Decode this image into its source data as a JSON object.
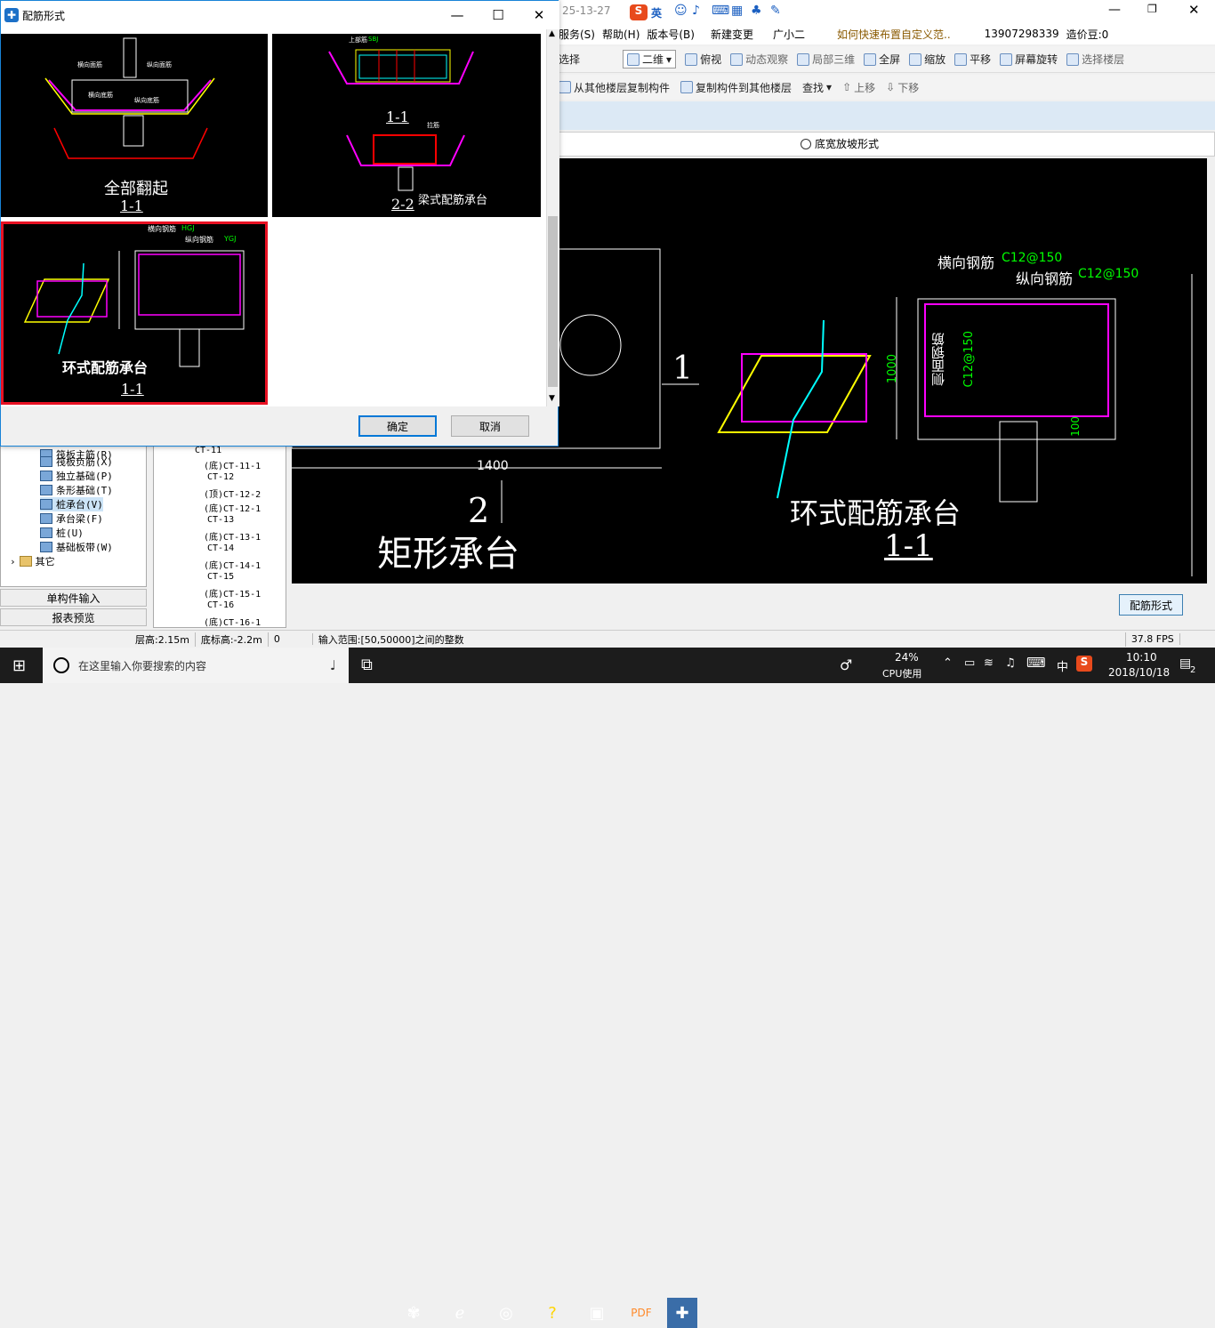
{
  "dialog": {
    "title": "配筋形式",
    "ok_label": "确定",
    "cancel_label": "取消",
    "thumb1_caption": "全部翻起",
    "thumb1_section": "1-1",
    "thumb2_top_label": "1-1",
    "thumb2_bottom_section": "2-2",
    "thumb2_caption": "梁式配筋承台",
    "thumb3_caption": "环式配筋承台",
    "thumb3_section": "1-1",
    "thumb3_label_transverse": "横向钢筋",
    "thumb3_code_transverse": "HGJ",
    "thumb3_label_longitudinal": "纵向钢筋",
    "thumb3_code_longitudinal": "YGJ",
    "thumb1_label_transverse_top": "横向面筋",
    "thumb1_label_longitudinal_top": "纵向面筋",
    "thumb1_label_transverse_bottom": "横向底筋",
    "thumb1_label_longitudinal_bottom": "纵向底筋",
    "thumb2_label_top": "上部筋",
    "thumb2_code_top": "SBJ",
    "thumb2_label_stirrup": "拉筋"
  },
  "app": {
    "menu": [
      "服务(S)",
      "帮助(H)",
      "版本号(B)",
      "新建变更",
      "广小二",
      "如何快速布置自定义范..",
      "13907298339",
      "造价豆:0"
    ],
    "toolbar1": [
      "选择",
      "二维",
      "俯视",
      "动态观察",
      "局部三维",
      "全屏",
      "缩放",
      "平移",
      "屏幕旋转",
      "选择楼层"
    ],
    "toolbar2": [
      "从其他楼层复制构件",
      "复制构件到其他楼层",
      "查找",
      "上移",
      "下移"
    ],
    "radio_label": "底宽放坡形式",
    "rebar_button": "配筋形式",
    "title_fragment": "25-13-27",
    "ime_label": "英"
  },
  "cad": {
    "label_transverse": "横向钢筋",
    "spec_transverse": "C12@150",
    "label_longitudinal": "纵向钢筋",
    "spec_longitudinal": "C12@150",
    "label_side": "侧面钢筋",
    "spec_side": "C12@150",
    "dim_height": "1000",
    "dim_bottom": "100",
    "dim_width": "1400",
    "section_mark": "1",
    "caption_ring": "环式配筋承台",
    "section_ring": "1-1",
    "num_rect": "2",
    "caption_rect": "矩形承台"
  },
  "left_tree": {
    "items": [
      "筏板主筋(R)",
      "筏板负筋(X)",
      "独立基础(P)",
      "条形基础(T)",
      "桩承台(V)",
      "承台梁(F)",
      "桩(U)",
      "基础板带(W)",
      "其它"
    ],
    "btn_single": "单构件输入",
    "btn_report": "报表预览"
  },
  "mid_tree": {
    "items": [
      "CT-11",
      "(底)CT-11-1",
      "CT-12",
      "(顶)CT-12-2",
      "(底)CT-12-1",
      "CT-13",
      "(底)CT-13-1",
      "CT-14",
      "(底)CT-14-1",
      "CT-15",
      "(底)CT-15-1",
      "CT-16",
      "(底)CT-16-1"
    ]
  },
  "status": {
    "floor_height": "层高:2.15m",
    "base_elev": "底标高:-2.2m",
    "value": "0",
    "hint": "输入范围:[50,50000]之间的整数",
    "fps": "37.8 FPS"
  },
  "taskbar": {
    "search_placeholder": "在这里输入你要搜索的内容",
    "cpu_percent": "24%",
    "cpu_label": "CPU使用",
    "ime": "中",
    "time": "10:10",
    "date": "2018/10/18",
    "notif_count": "2"
  }
}
